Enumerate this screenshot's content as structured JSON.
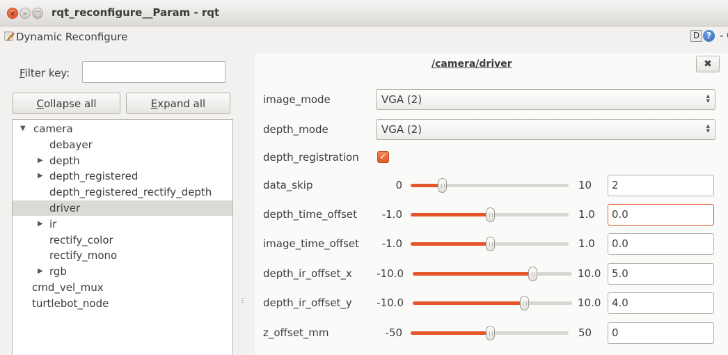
{
  "window": {
    "title": "rqt_reconfigure__Param - rqt",
    "close_glyph": "×",
    "minimize_glyph": "–",
    "maximize_glyph": "□"
  },
  "plugin": {
    "title": "Dynamic Reconfigure",
    "icon": "pencil-document-icon",
    "help_d": "D",
    "help_q": "?",
    "extra_buttons": "- O"
  },
  "filter": {
    "label_prefix": "F",
    "label_rest": "ilter key:",
    "value": ""
  },
  "buttons": {
    "collapse_prefix": "C",
    "collapse_rest": "ollapse all",
    "expand_prefix": "E",
    "expand_rest": "xpand all"
  },
  "tree": {
    "expanded_arrow": "▼",
    "collapsed_arrow": "▶",
    "items": [
      {
        "label": "camera",
        "level": 0,
        "arrow": "expanded",
        "selected": false
      },
      {
        "label": "debayer",
        "level": 1,
        "arrow": "none",
        "selected": false
      },
      {
        "label": "depth",
        "level": 1,
        "arrow": "collapsed",
        "selected": false
      },
      {
        "label": "depth_registered",
        "level": 1,
        "arrow": "collapsed",
        "selected": false
      },
      {
        "label": "depth_registered_rectify_depth",
        "level": 1,
        "arrow": "none",
        "selected": false
      },
      {
        "label": "driver",
        "level": 1,
        "arrow": "none",
        "selected": true
      },
      {
        "label": "ir",
        "level": 1,
        "arrow": "collapsed",
        "selected": false
      },
      {
        "label": "rectify_color",
        "level": 1,
        "arrow": "none",
        "selected": false
      },
      {
        "label": "rectify_mono",
        "level": 1,
        "arrow": "none",
        "selected": false
      },
      {
        "label": "rgb",
        "level": 1,
        "arrow": "collapsed",
        "selected": false
      },
      {
        "label": "cmd_vel_mux",
        "level": 0,
        "arrow": "none",
        "selected": false
      },
      {
        "label": "turtlebot_node",
        "level": 0,
        "arrow": "none",
        "selected": false
      }
    ]
  },
  "node": {
    "title": "/camera/driver",
    "close_glyph": "✖"
  },
  "params": {
    "image_mode": {
      "label": "image_mode",
      "value": "VGA (2)"
    },
    "depth_mode": {
      "label": "depth_mode",
      "value": "VGA (2)"
    },
    "depth_registration": {
      "label": "depth_registration",
      "checked": true,
      "check_glyph": "✓"
    },
    "sliders": [
      {
        "label": "data_skip",
        "min": "0",
        "max": "10",
        "value": "2",
        "fraction": 0.2,
        "focused": false
      },
      {
        "label": "depth_time_offset",
        "min": "-1.0",
        "max": "1.0",
        "value": "0.0",
        "fraction": 0.5,
        "focused": true
      },
      {
        "label": "image_time_offset",
        "min": "-1.0",
        "max": "1.0",
        "value": "0.0",
        "fraction": 0.5,
        "focused": false
      },
      {
        "label": "depth_ir_offset_x",
        "min": "-10.0",
        "max": "10.0",
        "value": "5.0",
        "fraction": 0.75,
        "focused": false
      },
      {
        "label": "depth_ir_offset_y",
        "min": "-10.0",
        "max": "10.0",
        "value": "4.0",
        "fraction": 0.7,
        "focused": false
      },
      {
        "label": "z_offset_mm",
        "min": "-50",
        "max": "50",
        "value": "0",
        "fraction": 0.5,
        "focused": false
      }
    ]
  },
  "colors": {
    "accent": "#e4562a",
    "selection": "#dcdad5"
  }
}
